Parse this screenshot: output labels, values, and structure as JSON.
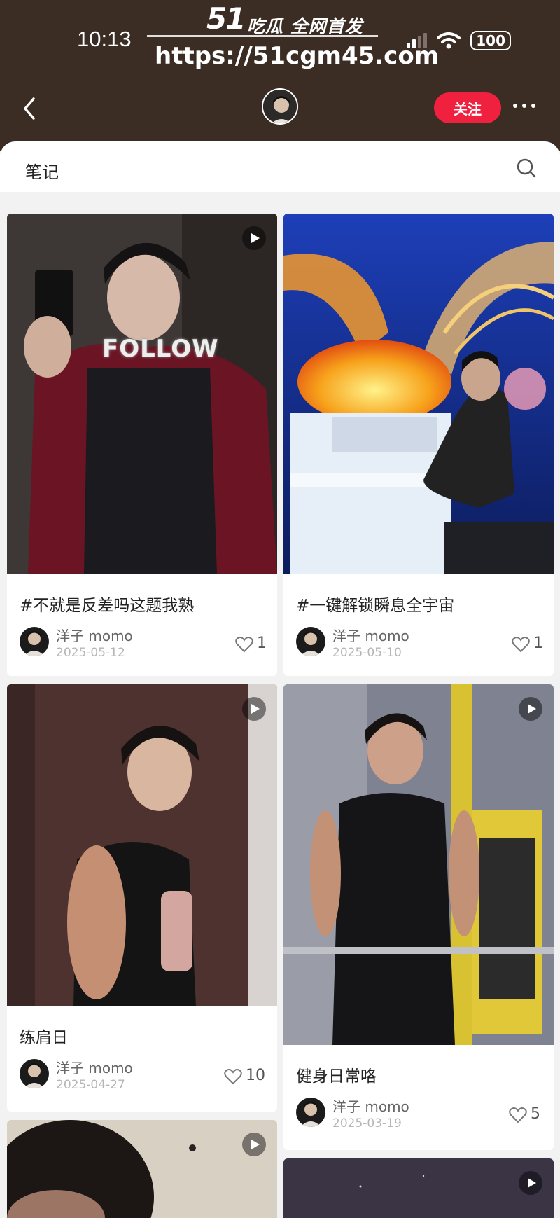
{
  "status": {
    "time": "10:13",
    "battery": "100"
  },
  "watermark": {
    "logo": "51",
    "title": "吃瓜 全网首发",
    "url": "https://51cgm45.com"
  },
  "header": {
    "follow_label": "关注"
  },
  "tabs": {
    "notes_label": "笔记"
  },
  "posts": [
    {
      "title": "#不就是反差吗这题我熟",
      "author": "洋子 momo",
      "date": "2025-05-12",
      "likes": "1",
      "overlay_text": "FOLLOW"
    },
    {
      "title": "#一键解锁瞬息全宇宙",
      "author": "洋子 momo",
      "date": "2025-05-10",
      "likes": "1"
    },
    {
      "title": "练肩日",
      "author": "洋子 momo",
      "date": "2025-04-27",
      "likes": "10"
    },
    {
      "title": "健身日常咯",
      "author": "洋子 momo",
      "date": "2025-03-19",
      "likes": "5"
    }
  ],
  "icons": [
    "back-icon",
    "search-icon",
    "play-icon",
    "heart-icon",
    "more-icon",
    "wifi-icon",
    "signal-icon"
  ]
}
